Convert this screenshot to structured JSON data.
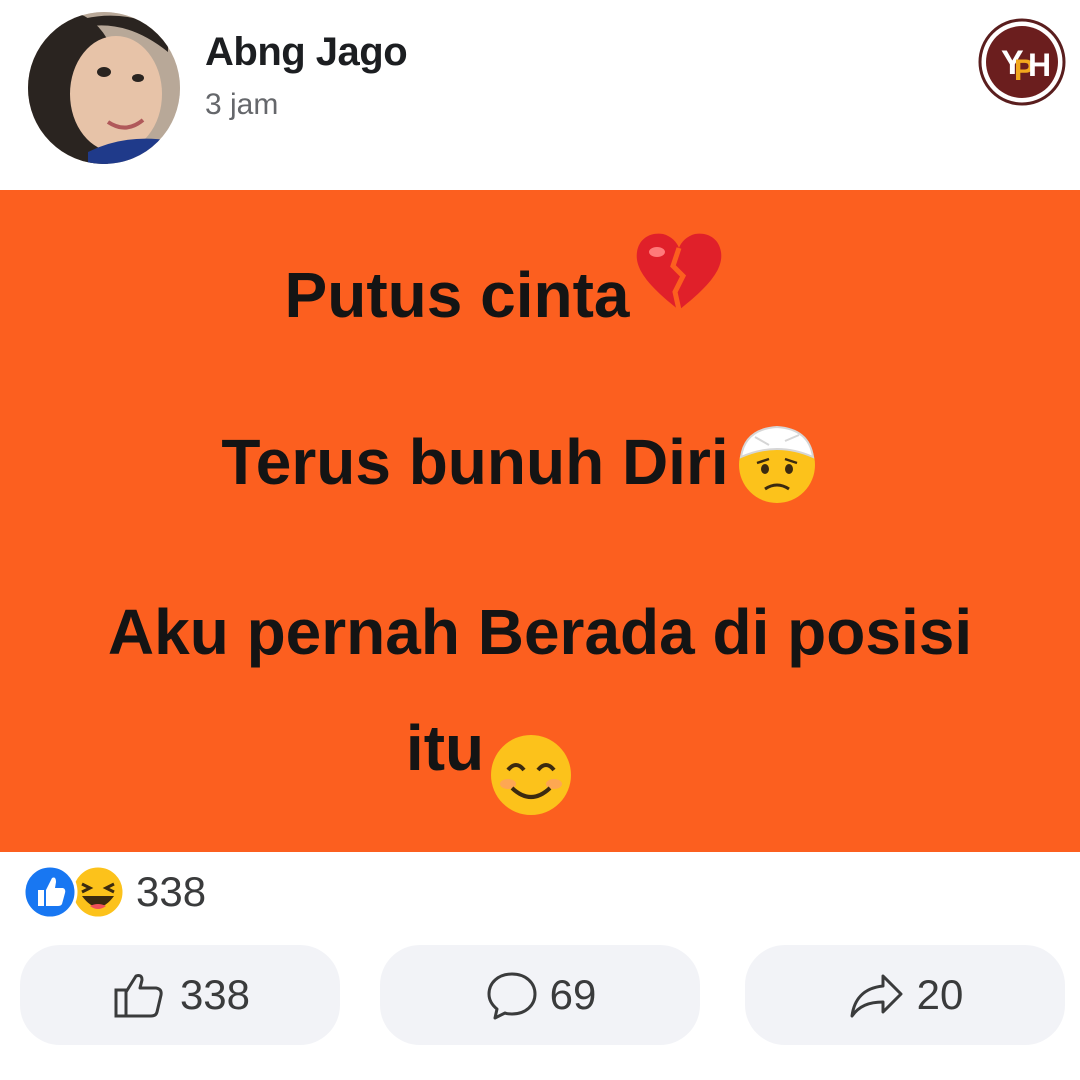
{
  "post": {
    "author_name": "Abng Jago",
    "timestamp": "3 jam",
    "lines": [
      "Putus cinta",
      "Terus bunuh Diri",
      "Aku pernah Berada di posisi",
      "itu"
    ],
    "background_color": "#fc5f1f",
    "emojis": [
      "broken-heart-icon",
      "bandaged-face-icon",
      "smiling-face-icon"
    ]
  },
  "reactions": {
    "icons": [
      "like-reaction-icon",
      "haha-reaction-icon"
    ],
    "count": "338"
  },
  "actions": {
    "like_count": "338",
    "comment_count": "69",
    "share_count": "20"
  },
  "colors": {
    "like_blue": "#1877f2",
    "text_primary": "#1c1e21",
    "text_secondary": "#65676b"
  }
}
